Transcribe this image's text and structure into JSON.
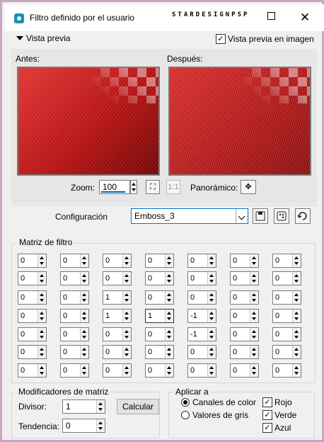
{
  "window": {
    "title": "Filtro definido por el usuario",
    "watermark": "STARDESIGNPSP",
    "close_glyph": "✕"
  },
  "preview": {
    "toggle_label": "Vista previa",
    "show_in_image_label": "Vista previa en imagen",
    "show_in_image_checked": true,
    "before_label": "Antes:",
    "after_label": "Después:"
  },
  "zoom": {
    "label": "Zoom:",
    "value": "100",
    "pan_label": "Panorámico:",
    "pan_icon": "move-icon"
  },
  "config": {
    "label": "Configuración",
    "preset": "Emboss_3",
    "icons": [
      "save-icon",
      "randomize-icon",
      "reset-icon"
    ]
  },
  "matrix": {
    "title": "Matriz de filtro",
    "rows": [
      [
        "0",
        "0",
        "0",
        "0",
        "0",
        "0",
        "0"
      ],
      [
        "0",
        "0",
        "0",
        "0",
        "0",
        "0",
        "0"
      ],
      [
        "0",
        "0",
        "1",
        "0",
        "0",
        "0",
        "0"
      ],
      [
        "0",
        "0",
        "1",
        "1",
        "-1",
        "0",
        "0"
      ],
      [
        "0",
        "0",
        "0",
        "0",
        "-1",
        "0",
        "0"
      ],
      [
        "0",
        "0",
        "0",
        "0",
        "0",
        "0",
        "0"
      ],
      [
        "0",
        "0",
        "0",
        "0",
        "0",
        "0",
        "0"
      ]
    ]
  },
  "modifiers": {
    "title": "Modificadores de matriz",
    "divisor_label": "Divisor:",
    "divisor_value": "1",
    "calc_button": "Calcular",
    "bias_label": "Tendencia:",
    "bias_value": "0"
  },
  "apply": {
    "title": "Aplicar a",
    "options": [
      "Canales de color",
      "Valores de gris"
    ],
    "selected": "Canales de color",
    "channels": [
      {
        "label": "Rojo",
        "checked": true
      },
      {
        "label": "Verde",
        "checked": true
      },
      {
        "label": "Azul",
        "checked": true
      }
    ]
  },
  "colors": {
    "frame": "#c9a6c2",
    "accent": "#0078d7",
    "preview_red": "#c81c1c"
  }
}
